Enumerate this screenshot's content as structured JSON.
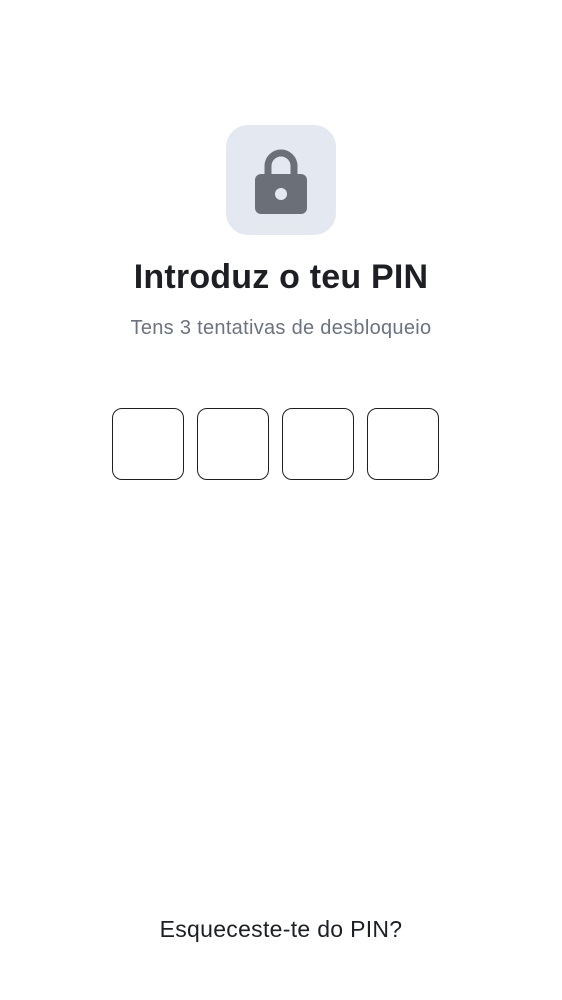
{
  "screen": {
    "title": "Introduz o teu PIN",
    "subtitle": "Tens 3 tentativas de desbloqueio",
    "lock_icon": "lock-icon",
    "pin": {
      "length": 4,
      "digits": [
        "",
        "",
        "",
        ""
      ]
    },
    "forgot_label": "Esqueceste-te do PIN?"
  },
  "colors": {
    "background": "#ffffff",
    "badge_bg": "#e4e8f1",
    "icon": "#6b7078",
    "text_primary": "#1d1f24",
    "text_secondary": "#6b7280"
  }
}
